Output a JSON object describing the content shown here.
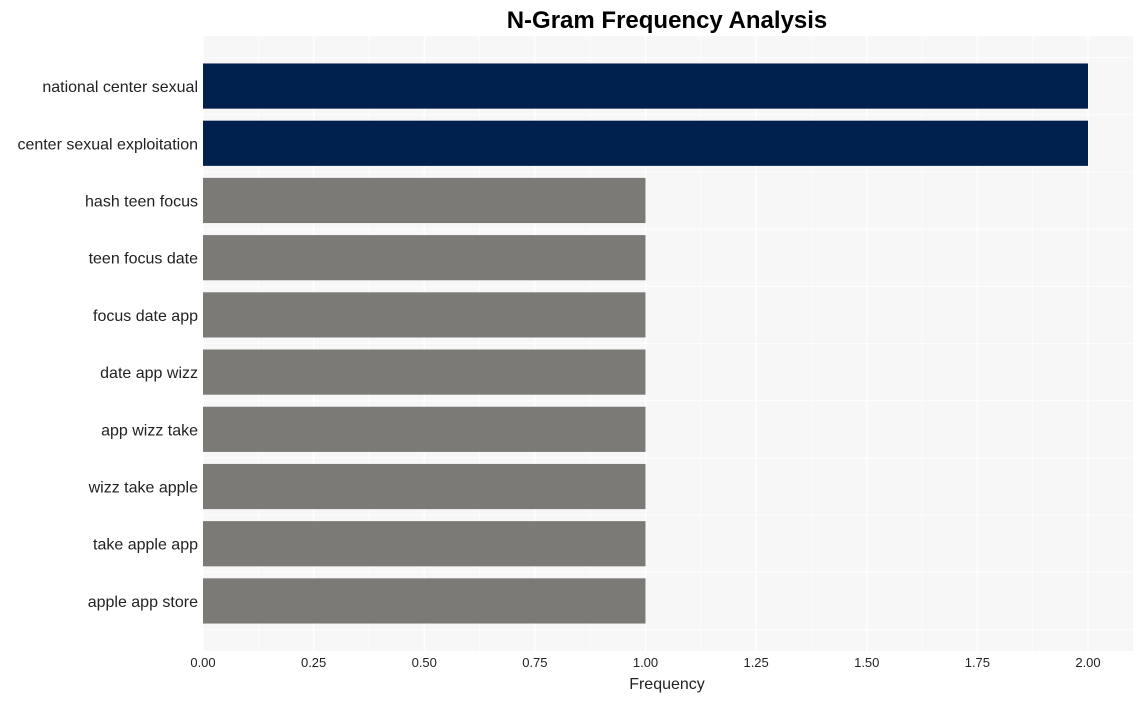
{
  "chart_data": {
    "type": "bar",
    "orientation": "horizontal",
    "title": "N-Gram Frequency Analysis",
    "xlabel": "Frequency",
    "ylabel": "",
    "xlim": [
      0,
      2.1
    ],
    "xticks": [
      "0.00",
      "0.25",
      "0.50",
      "0.75",
      "1.00",
      "1.25",
      "1.50",
      "1.75",
      "2.00"
    ],
    "xtick_values": [
      0,
      0.25,
      0.5,
      0.75,
      1.0,
      1.25,
      1.5,
      1.75,
      2.0
    ],
    "grid": true,
    "categories": [
      "national center sexual",
      "center sexual exploitation",
      "hash teen focus",
      "teen focus date",
      "focus date app",
      "date app wizz",
      "app wizz take",
      "wizz take apple",
      "take apple app",
      "apple app store"
    ],
    "values": [
      2,
      2,
      1,
      1,
      1,
      1,
      1,
      1,
      1,
      1
    ],
    "colors": {
      "highlight": "#00214d",
      "default": "#7b7a76",
      "plot_background": "#f7f7f7",
      "grid": "#ffffff"
    }
  }
}
